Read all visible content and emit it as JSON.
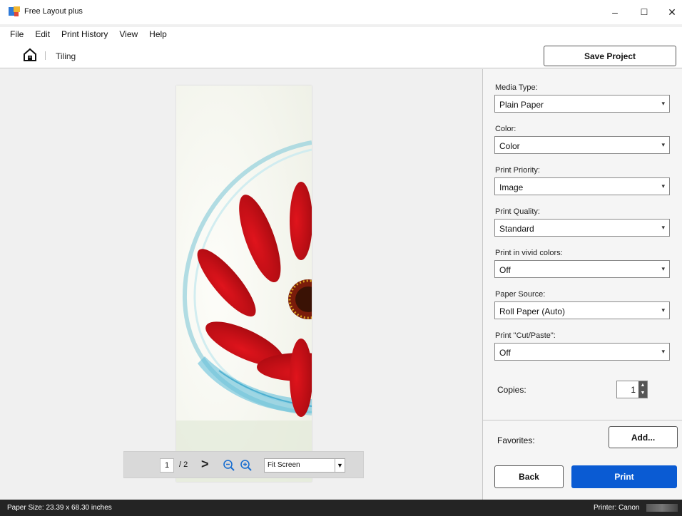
{
  "window": {
    "title": "Free Layout plus",
    "minimize": "–",
    "maximize": "☐",
    "close": "✕"
  },
  "menu": {
    "items": [
      "File",
      "Edit",
      "Print History",
      "View",
      "Help"
    ]
  },
  "toolbar": {
    "breadcrumb": "Tiling",
    "save_label": "Save Project"
  },
  "preview": {
    "current_page": "1",
    "total_pages": "/ 2",
    "next_glyph": ">",
    "zoom_value": "Fit Screen"
  },
  "settings": {
    "media_type": {
      "label": "Media Type:",
      "value": "Plain Paper"
    },
    "color": {
      "label": "Color:",
      "value": "Color"
    },
    "print_priority": {
      "label": "Print Priority:",
      "value": "Image"
    },
    "print_quality": {
      "label": "Print Quality:",
      "value": "Standard"
    },
    "vivid_colors": {
      "label": "Print in vivid colors:",
      "value": "Off"
    },
    "paper_source": {
      "label": "Paper Source:",
      "value": "Roll Paper (Auto)"
    },
    "cut_paste": {
      "label": "Print \"Cut/Paste\":",
      "value": "Off"
    },
    "copies": {
      "label": "Copies:",
      "value": "1"
    }
  },
  "favorites": {
    "label": "Favorites:",
    "add_label": "Add..."
  },
  "actions": {
    "back_label": "Back",
    "print_label": "Print"
  },
  "status": {
    "paper_size": "Paper Size: 23.39 x 68.30 inches",
    "printer": "Printer: Canon"
  },
  "colors": {
    "accent": "#0a5bd3",
    "statusbar": "#242424"
  }
}
